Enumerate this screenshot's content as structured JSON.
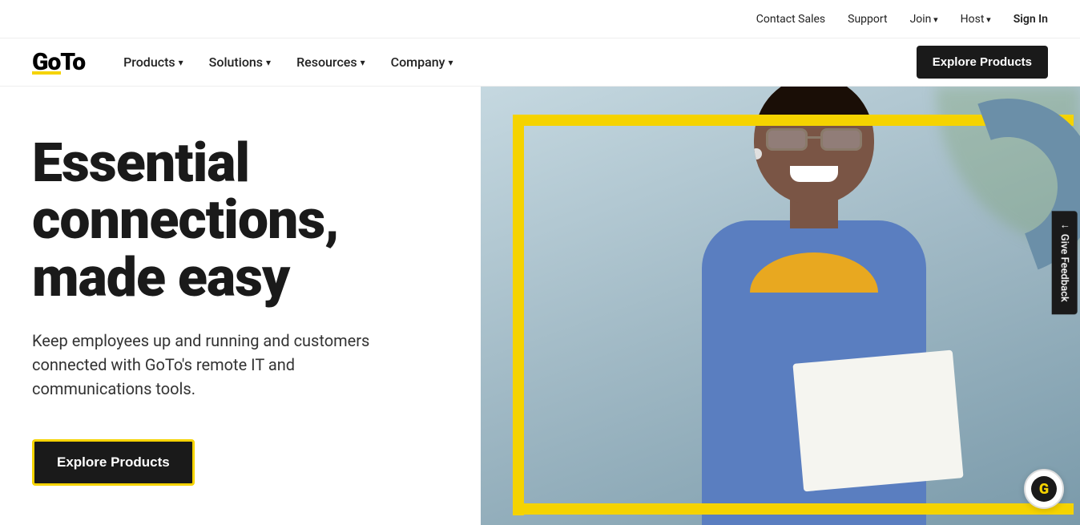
{
  "brand": {
    "name": "GoTo",
    "logo_text": "GoTo"
  },
  "top_nav": {
    "links": [
      {
        "label": "Contact Sales",
        "has_dropdown": false
      },
      {
        "label": "Support",
        "has_dropdown": false
      },
      {
        "label": "Join",
        "has_dropdown": true
      },
      {
        "label": "Host",
        "has_dropdown": true
      },
      {
        "label": "Sign In",
        "has_dropdown": false
      }
    ]
  },
  "main_nav": {
    "links": [
      {
        "label": "Products",
        "has_dropdown": true
      },
      {
        "label": "Solutions",
        "has_dropdown": true
      },
      {
        "label": "Resources",
        "has_dropdown": true
      },
      {
        "label": "Company",
        "has_dropdown": true
      }
    ],
    "cta_button": "Explore Products"
  },
  "hero": {
    "title": "Essential connections, made easy",
    "subtitle": "Keep employees up and running and customers connected with GoTo's remote IT and communications tools.",
    "cta_button": "Explore Products"
  },
  "feedback": {
    "label": "Give Feedback"
  },
  "chat": {
    "icon_letter": "G"
  }
}
